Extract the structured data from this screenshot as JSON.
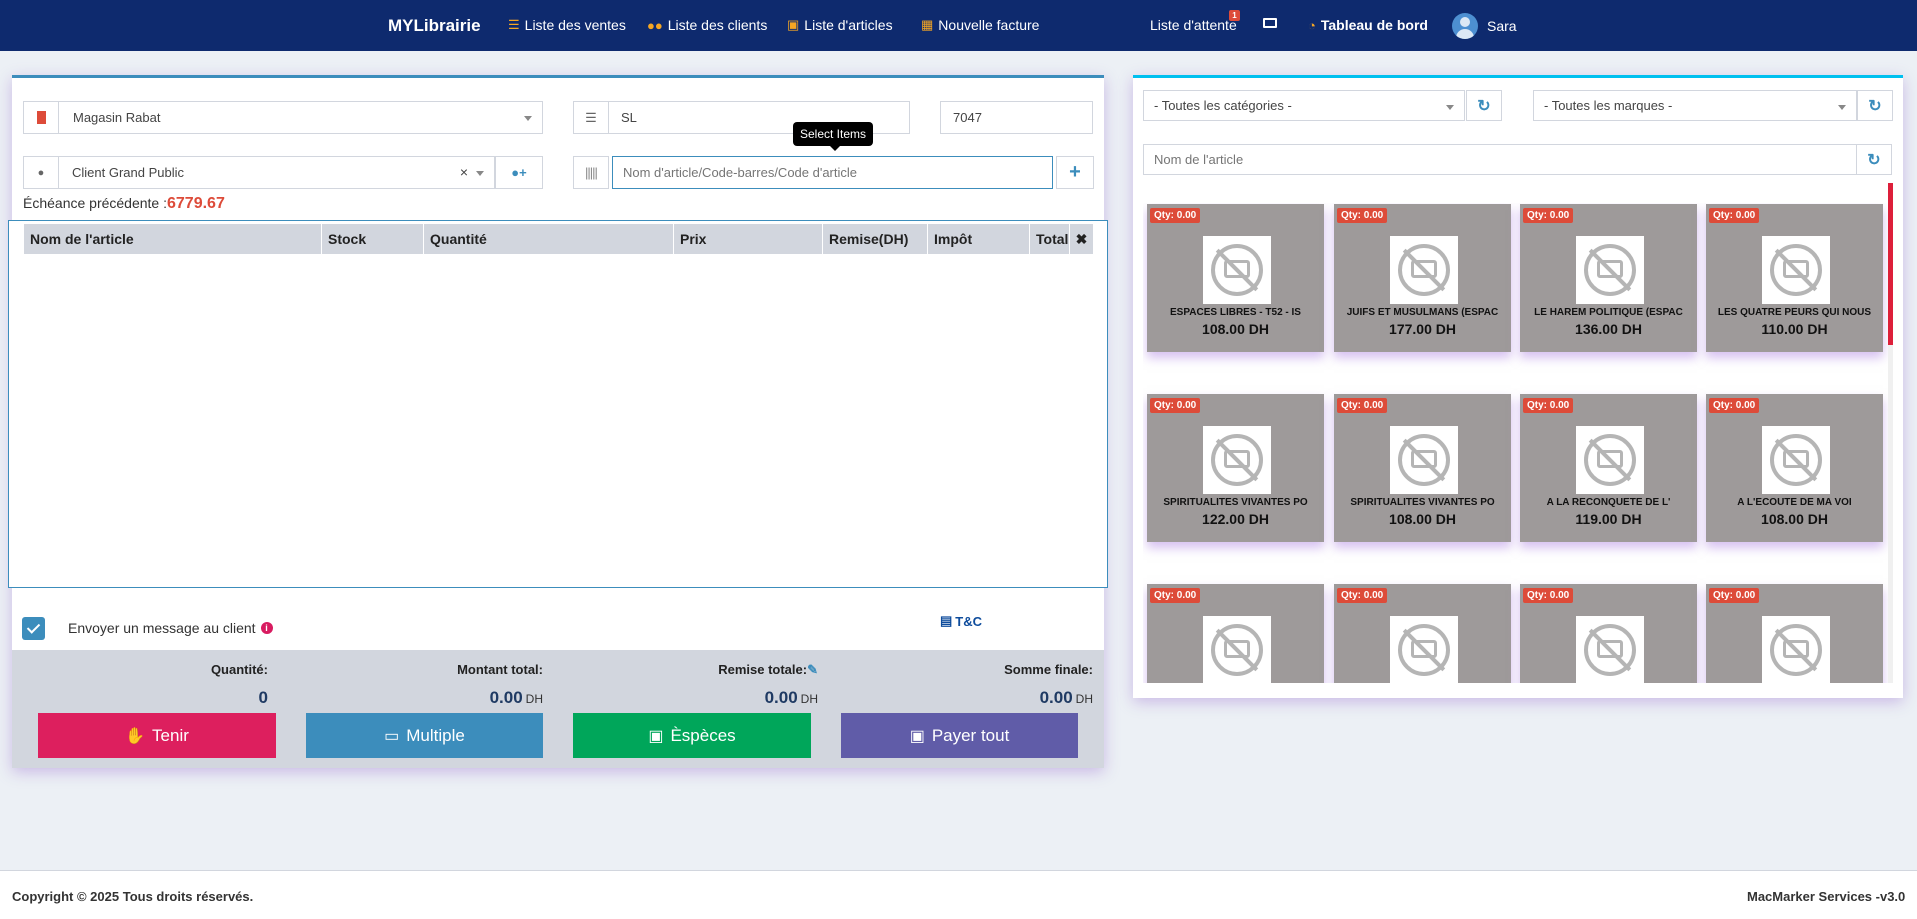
{
  "nav": {
    "brand": "MYLibrairie",
    "items": [
      {
        "label": "Liste des ventes",
        "icon": "list-icon"
      },
      {
        "label": "Liste des clients",
        "icon": "users-icon"
      },
      {
        "label": "Liste d'articles",
        "icon": "cubes-icon"
      },
      {
        "label": "Nouvelle facture",
        "icon": "calculator-icon"
      }
    ],
    "waitlist_label": "Liste d'attente",
    "waitlist_badge": "1",
    "dashboard_label": "Tableau de bord",
    "user_name": "Sara"
  },
  "form": {
    "store": "Magasin Rabat",
    "series": "SL",
    "invoice_number": "7047",
    "customer": "Client Grand Public",
    "search_placeholder": "Nom d'article/Code-barres/Code d'article",
    "tooltip": "Select Items",
    "due_label": "Échéance précédente :",
    "due_value": "6779.67"
  },
  "table": {
    "columns": [
      "Nom de l'article",
      "Stock",
      "Quantité",
      "Prix",
      "Remise(DH)",
      "Impôt",
      "Total",
      "✖"
    ]
  },
  "options": {
    "send_message_label": "Envoyer un message au client",
    "send_message_checked": true,
    "tc_label": "T&C"
  },
  "totals": {
    "quantity_label": "Quantité:",
    "quantity_value": "0",
    "amount_label": "Montant total:",
    "amount_value": "0.00",
    "discount_label": "Remise totale:",
    "discount_value": "0.00",
    "final_label": "Somme finale:",
    "final_value": "0.00",
    "currency": "DH"
  },
  "buttons": {
    "hold": "Tenir",
    "multiple": "Multiple",
    "cash": "Èspèces",
    "pay_all": "Payer tout"
  },
  "catalog": {
    "category_select": "- Toutes les catégories -",
    "brand_select": "- Toutes les marques -",
    "name_placeholder": "Nom de l'article",
    "products": [
      {
        "qty": "Qty: 0.00",
        "name": "ESPACES LIBRES - T52 - IS",
        "price": "108.00 DH"
      },
      {
        "qty": "Qty: 0.00",
        "name": "JUIFS ET MUSULMANS (ESPAC",
        "price": "177.00 DH"
      },
      {
        "qty": "Qty: 0.00",
        "name": "LE HAREM POLITIQUE (ESPAC",
        "price": "136.00 DH"
      },
      {
        "qty": "Qty: 0.00",
        "name": "LES QUATRE PEURS QUI NOUS",
        "price": "110.00 DH"
      },
      {
        "qty": "Qty: 0.00",
        "name": "SPIRITUALITES VIVANTES PO",
        "price": "122.00 DH"
      },
      {
        "qty": "Qty: 0.00",
        "name": "SPIRITUALITES VIVANTES PO",
        "price": "108.00 DH"
      },
      {
        "qty": "Qty: 0.00",
        "name": "A LA RECONQUETE DE L'",
        "price": "119.00 DH"
      },
      {
        "qty": "Qty: 0.00",
        "name": "A L'ECOUTE DE MA VOI",
        "price": "108.00 DH"
      },
      {
        "qty": "Qty: 0.00",
        "name": "",
        "price": ""
      },
      {
        "qty": "Qty: 0.00",
        "name": "",
        "price": ""
      },
      {
        "qty": "Qty: 0.00",
        "name": "",
        "price": ""
      },
      {
        "qty": "Qty: 0.00",
        "name": "",
        "price": ""
      }
    ]
  },
  "footer": {
    "copyright": "Copyright © 2025 Tous droits réservés.",
    "version": "MacMarker Services -v3.0"
  },
  "colors": {
    "navbar": "#0e2a6e",
    "hold_button": "#dd1f5e",
    "multiple_button": "#3c8dbc",
    "cash_button": "#00a65a",
    "pay_all_button": "#605ca8",
    "qty_badge": "#dd4b39",
    "due_value": "#dd4b39"
  }
}
